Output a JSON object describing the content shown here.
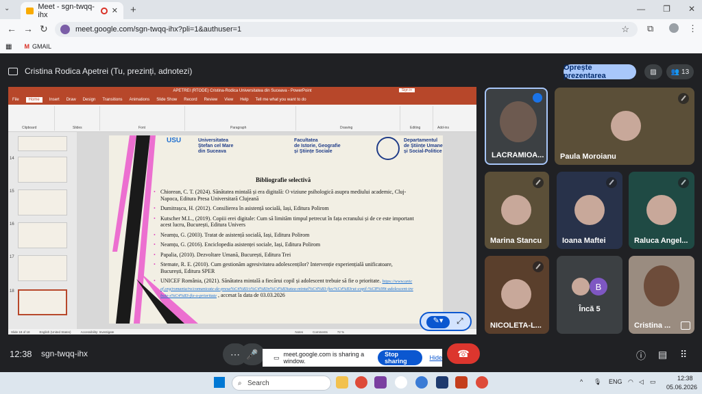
{
  "browser": {
    "tab_title": "Meet - sgn-twqq-ihx",
    "url": "meet.google.com/sgn-twqq-ihx?pli=1&authuser=1",
    "bookmark": "GMAIL"
  },
  "meet": {
    "presenter_text": "Cristina Rodica Apetrei (Tu, prezinți, adnotezi)",
    "stop_presenting": "Oprește prezentarea",
    "participant_count": "13",
    "time": "12:38",
    "meeting_code": "sgn-twqq-ihx",
    "share_notice": "meet.google.com is sharing a window.",
    "stop_sharing": "Stop sharing",
    "hide": "Hide"
  },
  "powerpoint": {
    "title": "APETREI (RTODE) Cristina-Rodica Universitatea din Suceava  -  PowerPoint",
    "sign_in": "Sign in",
    "menu": [
      "File",
      "Home",
      "Insert",
      "Draw",
      "Design",
      "Transitions",
      "Animations",
      "Slide Show",
      "Record",
      "Review",
      "View",
      "Help"
    ],
    "tell_me": "Tell me what you want to do",
    "ribbon_groups": [
      "Clipboard",
      "Slides",
      "Font",
      "Paragraph",
      "Drawing",
      "Editing",
      "Add-ins"
    ],
    "thumb_numbers": [
      "14",
      "15",
      "16",
      "17",
      "18"
    ],
    "status": [
      "Slide 18 of 18",
      "English (United States)",
      "Accessibility: Investigate",
      "Notes",
      "Comments",
      "72 %"
    ]
  },
  "slide": {
    "logo1": "Universitatea\nȘtefan cel Mare\ndin Suceava",
    "logo1_abbr": "USU",
    "logo2": "Facultatea\nde Istorie, Geografie\nși Științe Sociale",
    "logo3": "Departamentul\nde Științe Umane\nși Social-Politice",
    "title": "Bibliografie selectivă",
    "refs": [
      "Chiorean, C. T. (2024). Sănătatea mintală și era digitală: O viziune psihologică asupra mediului academic, Cluj-Napoca, Editura Presa Universitară Clujeană",
      "Dumitrașcu, H. (2012). Consilierea în asistență socială, Iași, Editura Polirom",
      "Kutscher M.L., (2019). Copiii erei digitale: Cum să limităm timpul petrecut în fața ecranului și de ce este important acest lucru, București, Editura Univers",
      "Neamțu, G. (2003). Tratat de asistență socială, Iași, Editura Polirom",
      "Neamțu, G. (2016). Enciclopedia asistenței sociale, Iași, Editura Polirom",
      "Papalia, (2010). Dezvoltare Umană, București, Editura Trei",
      "Stemate, R. E. (2010). Cum gestionăm agresivitatea adolescenților? Intervenție experiențială unificatoare, București, Editura SPER",
      "UNICEF România, (2021). Sănătatea mintală a fiecărui copil și adolescent trebuie să fie o prioritate."
    ],
    "link": "https://www.unicef.org/romania/ro/comunicate-de-presa%C4%83/s%C4%83n%C4%83tatea-mintal%C4%83-fiec%C4%83rui-copil-%C8%99i-adolescent-trebuie-s%C4%83-fie-o-prioritate",
    "accessed": ", accesat la data de 03.03.2026"
  },
  "participants": [
    "LACRAMIOA...",
    "Paula Moroianu",
    "Marina Stancu",
    "Ioana Maftei",
    "Raluca Angel...",
    "NICOLETA-L...",
    "Încă 5",
    "Cristina ..."
  ],
  "more_initial": "B",
  "taskbar": {
    "search": "Search",
    "lang": "ENG",
    "clock_time": "12:38",
    "clock_date": "05.06.2026"
  }
}
